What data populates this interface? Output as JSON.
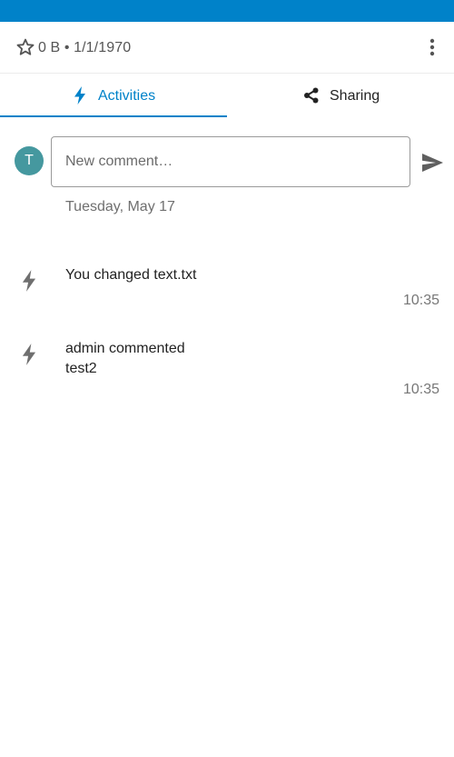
{
  "file_header": {
    "info": "0 B • 1/1/1970",
    "icons": {
      "favorite": "star-outline-icon",
      "menu": "more-vertical-icon"
    }
  },
  "tabs": [
    {
      "label": "Activities",
      "icon": "lightning-icon",
      "selected": true
    },
    {
      "label": "Sharing",
      "icon": "share-icon",
      "selected": false
    }
  ],
  "comment": {
    "avatar_initial": "T",
    "avatar_color": "#45989f",
    "placeholder": "New comment…",
    "value": "",
    "send_icon": "send-icon"
  },
  "activity_section": {
    "date": "Tuesday, May 17",
    "items": [
      {
        "icon": "lightning-icon",
        "text": "You changed text.txt",
        "detail": "",
        "time": "10:35"
      },
      {
        "icon": "lightning-icon",
        "text": "admin commented",
        "detail": "test2",
        "time": "10:35"
      }
    ]
  },
  "colors": {
    "accent": "#0082c9",
    "icon_gray": "#6f6f6f"
  }
}
